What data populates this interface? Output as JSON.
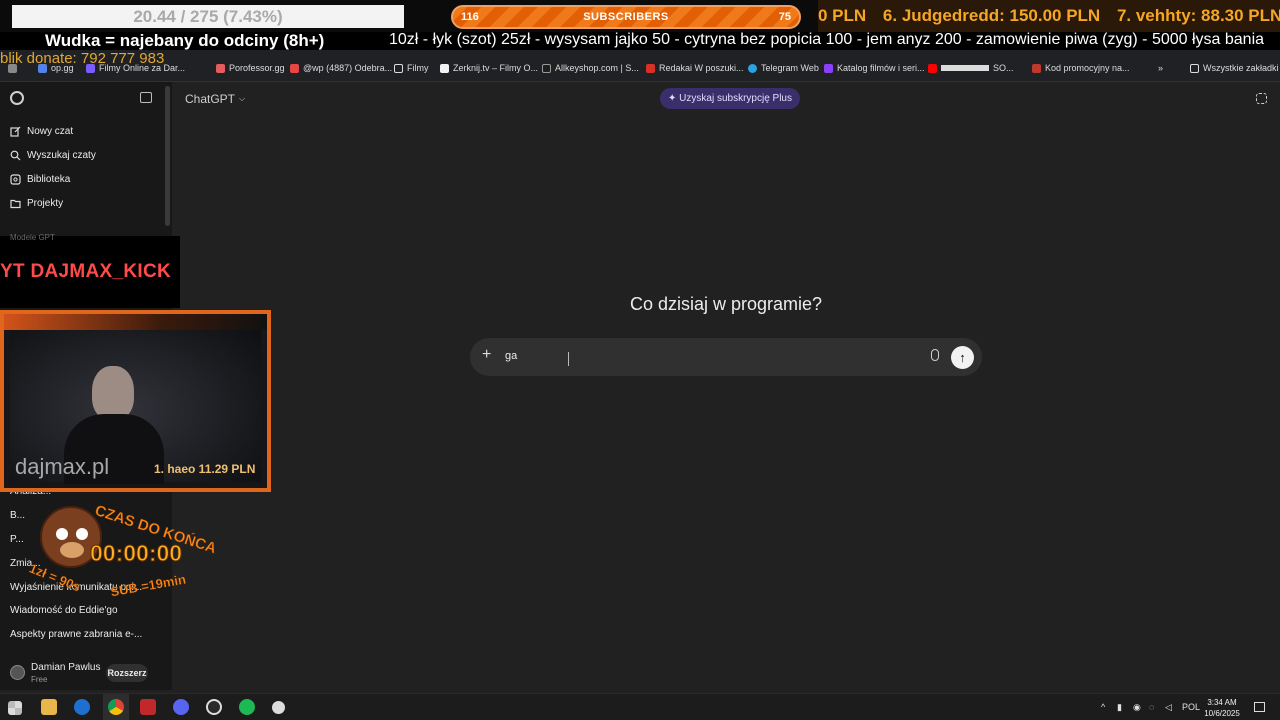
{
  "overlay": {
    "sub_goal": "20.44 / 275 (7.43%)",
    "sub_count_left": "116",
    "sub_label": "SUBSCRIBERS",
    "sub_count_right": "75",
    "donors": [
      "0 PLN",
      "6. Judgedredd: 150.00 PLN",
      "7. vehhty: 88.30 PLN"
    ],
    "ticker_left": "Wudka = najebany do odciny (8h+)",
    "ticker_right": "10zł - łyk (szot) 25zł - wysysam jajko  50 - cytryna bez popicia 100 - jem anyz 200 - zamowienie piwa (zyg) - 5000 łysa bania",
    "blik": "blik donate: 792 777 983",
    "yt_banner": "YT DAJMAX_KICK",
    "watermark": "dajmax.pl",
    "cam_donor": "1. haeo 11.29 PLN",
    "timer_title": "CZAS DO KOŃCA",
    "timer_value": "00:00:00",
    "timer_left": "1zł = 90s",
    "timer_right": "SUB =19min"
  },
  "bookmarks": [
    {
      "label": "op.gg",
      "color": "#5383e8"
    },
    {
      "label": "Filmy Online za Dar...",
      "color": "#7b5cff"
    },
    {
      "label": "Porofessor.gg",
      "color": "#e65c5c"
    },
    {
      "label": "@wp (4887) Odebra...",
      "color": "#e84545"
    },
    {
      "label": "Filmy",
      "color": "#dcdcdc"
    },
    {
      "label": "Zerknij.tv – Filmy O...",
      "color": "#f2f2f2"
    },
    {
      "label": "Allkeyshop.com | S...",
      "color": "#1e1e1e"
    },
    {
      "label": "Redakai W poszuki...",
      "color": "#d93025"
    },
    {
      "label": "Telegram Web",
      "color": "#2aa3e0"
    },
    {
      "label": "Katalog filmów i seri...",
      "color": "#8a3ffc"
    },
    {
      "label": "SO...",
      "color": "#ff0000"
    },
    {
      "label": "Kod promocyjny na...",
      "color": "#c0392b"
    }
  ],
  "bookmarks_all": "Wszystkie zakładki",
  "sidebar": {
    "new_chat": "Nowy czat",
    "search": "Wyszukaj czaty",
    "library": "Biblioteka",
    "projects": "Projekty",
    "section_faded": "Modele GPT",
    "chats": [
      "Analiza...",
      "B...",
      "P...",
      "Zmia...",
      "Wyjaśnienie komunikatu pol...",
      "Wiadomość do Eddie'go",
      "Aspekty prawne zabrania e-..."
    ],
    "user_name": "Damian Pawlus",
    "user_plan": "Free",
    "upgrade": "Rozszerz"
  },
  "main": {
    "model": "ChatGPT",
    "plus_cta": "Uzyskaj subskrypcję Plus",
    "heading": "Co dzisiaj w programie?",
    "composer_value": "ga"
  },
  "taskbar": {
    "lang": "POL",
    "time": "3:34 AM",
    "date": "10/6/2025"
  }
}
